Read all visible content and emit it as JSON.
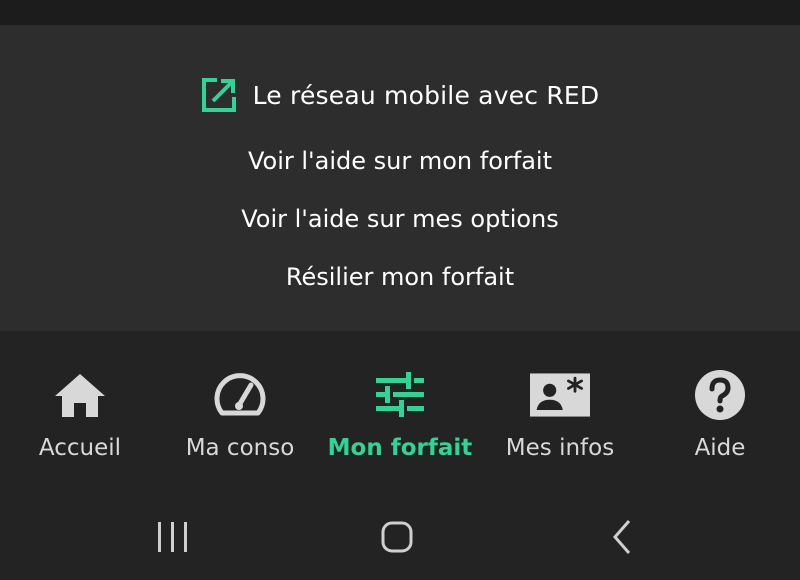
{
  "colors": {
    "accent": "#2ed597",
    "panel_bg": "#2d2d2d",
    "nav_bg": "#232323",
    "icon_gray": "#d8d8d8"
  },
  "external_link": {
    "icon": "external-link-icon",
    "label": "Le réseau mobile avec RED"
  },
  "help_links": [
    "Voir l'aide sur mon forfait",
    "Voir l'aide sur mes options",
    "Résilier mon forfait"
  ],
  "bottom_nav": {
    "active_index": 2,
    "items": [
      {
        "label": "Accueil",
        "icon": "home-icon"
      },
      {
        "label": "Ma conso",
        "icon": "speedometer-icon"
      },
      {
        "label": "Mon forfait",
        "icon": "sliders-icon"
      },
      {
        "label": "Mes infos",
        "icon": "profile-card-icon"
      },
      {
        "label": "Aide",
        "icon": "help-icon"
      }
    ]
  },
  "system_nav": {
    "recents": "recents-icon",
    "home": "home-button-icon",
    "back": "back-icon"
  }
}
